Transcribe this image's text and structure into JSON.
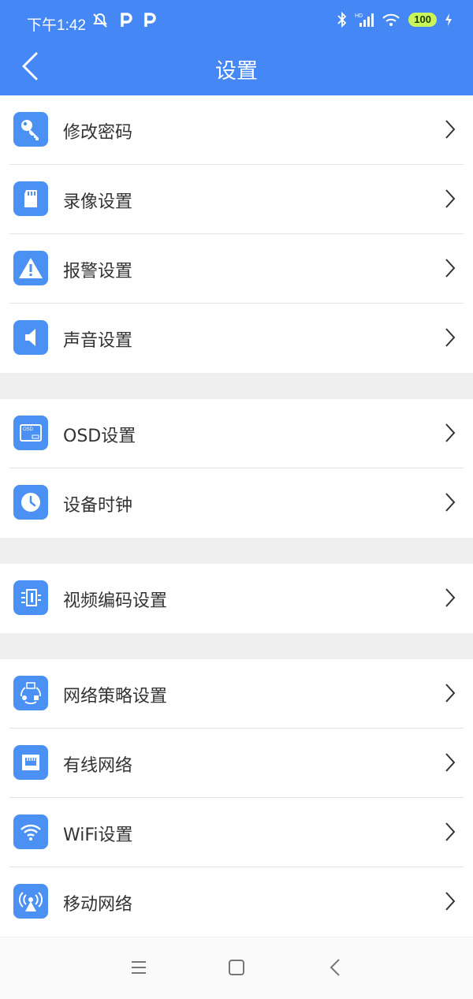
{
  "status": {
    "time": "下午1:42",
    "battery": "100"
  },
  "header": {
    "title": "设置"
  },
  "groups": [
    {
      "items": [
        {
          "label": "修改密码",
          "icon": "key-icon"
        },
        {
          "label": "录像设置",
          "icon": "sd-card-icon"
        },
        {
          "label": "报警设置",
          "icon": "warning-icon"
        },
        {
          "label": "声音设置",
          "icon": "speaker-icon"
        }
      ]
    },
    {
      "items": [
        {
          "label": "OSD设置",
          "icon": "osd-icon"
        },
        {
          "label": "设备时钟",
          "icon": "clock-icon"
        }
      ]
    },
    {
      "items": [
        {
          "label": "视频编码设置",
          "icon": "video-encode-icon"
        }
      ]
    },
    {
      "items": [
        {
          "label": "网络策略设置",
          "icon": "network-policy-icon"
        },
        {
          "label": "有线网络",
          "icon": "ethernet-icon"
        },
        {
          "label": "WiFi设置",
          "icon": "wifi-icon"
        },
        {
          "label": "移动网络",
          "icon": "cellular-tower-icon"
        }
      ]
    }
  ],
  "colors": {
    "accent": "#4587f5",
    "icon_bg": "#4a91f3",
    "separator": "#efefef"
  }
}
